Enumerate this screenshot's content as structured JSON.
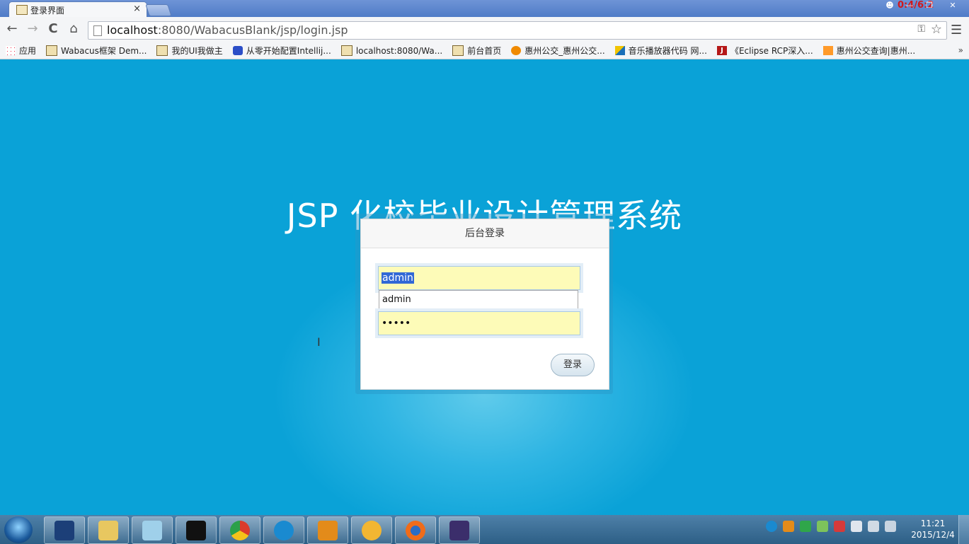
{
  "browser": {
    "tab_title": "登录界面",
    "tab_close": "×",
    "overlay_text": "0:4/6:2",
    "url_host": "localhost",
    "url_rest": ":8080/WabacusBlank/jsp/login.jsp",
    "nav_back": "←",
    "nav_forward": "→",
    "nav_reload": "C",
    "nav_home": "⌂",
    "bookmarks": [
      {
        "label": "应用",
        "icon": "apps-icon"
      },
      {
        "label": "Wabacus框架 Dem...",
        "icon": "page-icon"
      },
      {
        "label": "我的UI我做主",
        "icon": "page-icon"
      },
      {
        "label": "从零开始配置Intellij...",
        "icon": "paw-icon"
      },
      {
        "label": "localhost:8080/Wa...",
        "icon": "page-icon"
      },
      {
        "label": "前台首页",
        "icon": "page-icon"
      },
      {
        "label": "惠州公交_惠州公交...",
        "icon": "bus-icon"
      },
      {
        "label": "音乐播放器代码 网...",
        "icon": "music-icon"
      },
      {
        "label": "《Eclipse RCP深入...",
        "icon": "j-icon"
      },
      {
        "label": "惠州公交查询|惠州...",
        "icon": "hui-icon"
      }
    ],
    "bookmarks_more": "»"
  },
  "page": {
    "heading": "JSP 化校毕业设计管理系统",
    "login": {
      "title": "后台登录",
      "username_value": "admin",
      "autocomplete_option": "admin",
      "password_value": "•••••",
      "submit_label": "登录"
    }
  },
  "taskbar": {
    "time": "11:21",
    "date": "2015/12/4",
    "apps": [
      "s-app-icon",
      "explorer-icon",
      "notepad-icon",
      "cmd-icon",
      "chrome-icon",
      "k-icon",
      "search-tool-icon",
      "squirrel-icon",
      "firefox-icon",
      "javaee-ide-icon"
    ]
  },
  "colors": {
    "page_background": "#0aa2d7",
    "autofill_yellow": "#fdfbb8",
    "selection_blue": "#3168d6"
  }
}
